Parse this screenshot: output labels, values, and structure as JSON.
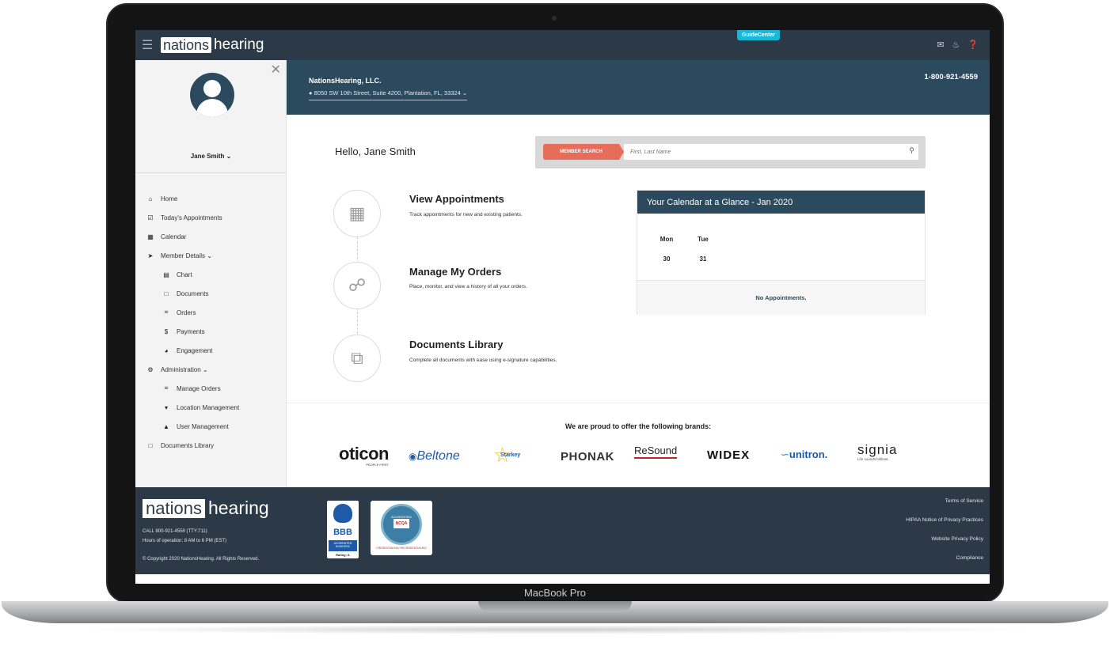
{
  "device": {
    "label": "MacBook Pro"
  },
  "topbar": {
    "logo_box": "nations",
    "logo_text": "hearing",
    "guide_label": "GuideCenter"
  },
  "sidebar": {
    "user_name": "Jane Smith ⌄",
    "items": [
      {
        "label": "Home",
        "icon": "home-icon",
        "glyph": "⌂",
        "level": 0
      },
      {
        "label": "Today's Appointments",
        "icon": "calendar-check-icon",
        "glyph": "☑",
        "level": 0
      },
      {
        "label": "Calendar",
        "icon": "calendar-icon",
        "glyph": "▦",
        "level": 0
      },
      {
        "label": "Member Details ⌄",
        "icon": "paper-plane-icon",
        "glyph": "➤",
        "level": 0
      },
      {
        "label": "Chart",
        "icon": "id-card-icon",
        "glyph": "▤",
        "level": 1
      },
      {
        "label": "Documents",
        "icon": "document-icon",
        "glyph": "□",
        "level": 1
      },
      {
        "label": "Orders",
        "icon": "cart-icon",
        "glyph": "⌗",
        "level": 1
      },
      {
        "label": "Payments",
        "icon": "dollar-icon",
        "glyph": "$",
        "level": 1
      },
      {
        "label": "Engagement",
        "icon": "chart-pie-icon",
        "glyph": "◕",
        "level": 1
      },
      {
        "label": "Administration ⌄",
        "icon": "cogs-icon",
        "glyph": "⚙",
        "level": 0
      },
      {
        "label": "Manage Orders",
        "icon": "cart-arrow-icon",
        "glyph": "⌗",
        "level": 1
      },
      {
        "label": "Location Management",
        "icon": "map-pin-icon",
        "glyph": "▾",
        "level": 1
      },
      {
        "label": "User Management",
        "icon": "user-icon",
        "glyph": "▲",
        "level": 1
      },
      {
        "label": "Documents Library",
        "icon": "document-icon",
        "glyph": "□",
        "level": 0
      }
    ]
  },
  "header": {
    "company": "NationsHearing, LLC.",
    "address": "8050 SW 10th Street, Suite 4200, Plantation, FL, 33324 ⌄",
    "phone": "1-800-921-4559"
  },
  "main": {
    "greeting": "Hello, Jane Smith",
    "search": {
      "button": "MEMBER SEARCH",
      "placeholder": "First, Last Name"
    },
    "features": [
      {
        "title": "View Appointments",
        "desc": "Track appointments for new and existing patients.",
        "icon": "calendar-icon"
      },
      {
        "title": "Manage My Orders",
        "desc": "Place, monitor, and view a history of all your orders.",
        "icon": "cart-check-icon"
      },
      {
        "title": "Documents Library",
        "desc": "Complete all documents with ease using e-signature capabilities.",
        "icon": "documents-icon"
      }
    ],
    "calendar": {
      "title": "Your Calendar at a Glance - Jan 2020",
      "days": [
        "Mon",
        "Tue"
      ],
      "dates": [
        "30",
        "31"
      ],
      "empty": "No Appointments."
    },
    "brands_title": "We are proud to offer the following brands:",
    "brands": [
      {
        "name": "oticon",
        "tagline": "PEOPLE FIRST"
      },
      {
        "name": "Beltone"
      },
      {
        "name": "Starkey"
      },
      {
        "name": "PHONAK"
      },
      {
        "name": "ReSound"
      },
      {
        "name": "WIDEX"
      },
      {
        "name": "unitron."
      },
      {
        "name": "signia",
        "tagline": "Life sounds brilliant."
      }
    ]
  },
  "footer": {
    "logo_box": "nations",
    "logo_text": "hearing",
    "call": "CALL 800-921-4559 (TTY:711)",
    "hours": "Hours of operation: 8 AM to 6 PM (EST)",
    "copyright": "© Copyright 2020 NationsHearing. All Rights Reserved.",
    "bbb": {
      "text": "BBB",
      "badge": "ACCREDITED BUSINESS",
      "rating": "Rating: A"
    },
    "ncqa": {
      "acc": "ACCREDITED",
      "name": "NCQA",
      "cred": "CREDENTIALING/ RECREDENTIALING"
    },
    "links": [
      "Terms of Service",
      "HIPAA Notice of Privacy Practices",
      "Website Privacy Policy",
      "Compliance"
    ]
  },
  "colors": {
    "header": "#2c4a5e",
    "topbar": "#2c3a47",
    "accent": "#e86c5a",
    "guide": "#19b8d6"
  }
}
